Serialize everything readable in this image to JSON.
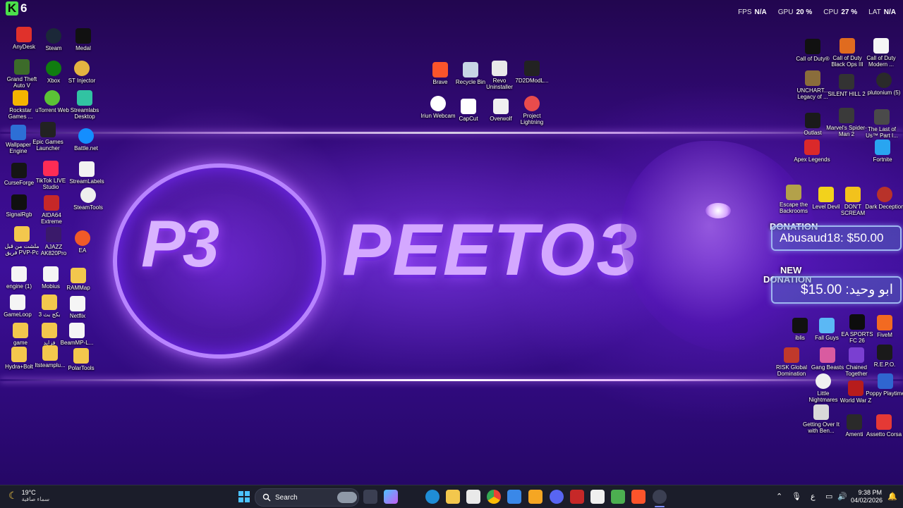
{
  "overlay": {
    "logo_letter": "K",
    "logo_number": "6"
  },
  "hud": [
    {
      "key": "FPS",
      "value": "N/A"
    },
    {
      "key": "GPU",
      "value": "20 %"
    },
    {
      "key": "CPU",
      "value": "27 %"
    },
    {
      "key": "LAT",
      "value": "N/A"
    }
  ],
  "wallpaper": {
    "brand_name": "PEETO3",
    "logo_mark": "P3"
  },
  "donations": {
    "first": {
      "tag": "DONATION",
      "text": "Abusaud18: $50.00"
    },
    "second": {
      "tag_line1": "NEW",
      "tag_line2": "DONATION",
      "text": "ابو وحيد: 15.00$"
    }
  },
  "icons": {
    "anydesk": "AnyDesk",
    "steam": "Steam",
    "medal": "Medal",
    "gta": "Grand Theft Auto V",
    "xbox": "Xbox",
    "st_injector": "ST Injector",
    "rockstar": "Rockstar Games ...",
    "utorrent": "uTorrent Web",
    "streamlabs": "Streamlabs Desktop",
    "wallpaper_engine": "Wallpaper Engine",
    "epic": "Epic Games Launcher",
    "battlenet": "Battle.net",
    "curseforge": "CurseForge",
    "tiktok": "TikTok LIVE Studio",
    "streamlabels": "StreamLabels",
    "signalrgb": "SignalRgb",
    "aida64": "AIDA64 Extreme",
    "steamtools": "SteamTools",
    "arabic_folder": "ملشت من قبل فريق PVP-Pc",
    "ajazz": "AJAZZ AK820Pro",
    "ea": "EA",
    "engine": "engine (1)",
    "mobius": "Mobius",
    "rammap": "RAMMap",
    "gameloop": "GameLoop",
    "arabic_zip": "بكج بث 3",
    "netflix": "Netflix",
    "game": "game",
    "arabic_folder2": "فزايد",
    "beammp": "BeamMP-L...",
    "hydra": "Hydra+Bolt",
    "itsteam": "Itsteamplu...",
    "polartools": "PolarTools",
    "brave": "Brave",
    "recycle": "Recycle Bin",
    "revo": "Revo Uninstaller",
    "7d2d": "7D2DModL...",
    "iriun": "Iriun Webcam",
    "capcut": "CapCut",
    "overwolf": "Overwolf",
    "project_lightning": "Project Lightning",
    "cod": "Call of Duty®",
    "cod_bo3": "Call of Duty Black Ops III",
    "cod_mw": "Call of Duty Modern ...",
    "uncharted": "UNCHART... Legacy of ...",
    "silent_hill": "SILENT HILL 2",
    "plutonium": "plutonium (5)",
    "outlast": "Outlast",
    "spiderman": "Marvel's Spider-Man 2",
    "last_of_us": "The Last of Us™ Part I...",
    "apex": "Apex Legends",
    "fortnite": "Fortnite",
    "escape": "Escape the Backrooms",
    "level_devil": "Level Devil",
    "dont_scream": "DON'T SCREAM",
    "dark_deception": "Dark Deception",
    "iblis": "iblis",
    "fall_guys": "Fall Guys",
    "fc26": "EA SPORTS FC 26",
    "fivem": "FiveM",
    "risk": "RISK Global Domination",
    "gang_beasts": "Gang Beasts",
    "chained": "Chained Together",
    "repo": "R.E.P.O.",
    "little_nightmares": "Little Nightmares",
    "world_war_z": "World War Z",
    "poppy": "Poppy Playtime",
    "getting_over": "Getting Over It with Ben...",
    "amenti": "Amenti",
    "assetto": "Assetto Corsa"
  },
  "taskbar": {
    "weather_temp": "19°C",
    "weather_cond": "سماء صافية",
    "search_placeholder": "Search",
    "lang": "ع",
    "time": "9:38 PM",
    "date": "04/02/2026"
  },
  "colors": {
    "accent": "#9b4dff",
    "taskbar": "#1b1d2a",
    "donation_border": "#9fb6f0"
  }
}
